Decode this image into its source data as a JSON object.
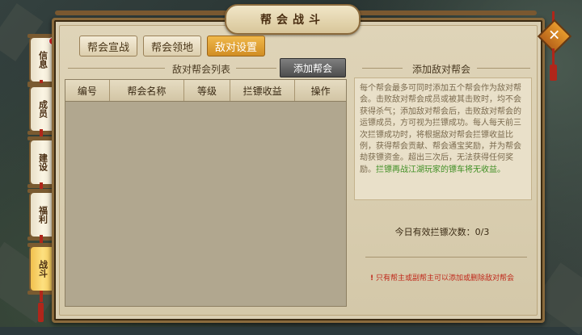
{
  "window": {
    "title": "帮会战斗"
  },
  "tabs": [
    {
      "label": "帮会宣战",
      "active": false
    },
    {
      "label": "帮会领地",
      "active": false
    },
    {
      "label": "敌对设置",
      "active": true
    }
  ],
  "left_section": {
    "title": "敌对帮会列表",
    "add_button": "添加帮会",
    "columns": [
      "编号",
      "帮会名称",
      "等级",
      "拦镖收益",
      "操作"
    ],
    "rows": []
  },
  "right_section": {
    "title": "添加敌对帮会",
    "description": "每个帮会最多可同时添加五个帮会作为敌对帮会。击败敌对帮会成员或被其击败时，均不会获得杀气；添加敌对帮会后，击败敌对帮会的运镖成员，方可视为拦镖成功。每人每天前三次拦镖成功时，将根据敌对帮会拦镖收益比例，获得帮会贡献、帮会通宝奖励，并为帮会劫获镖资金。超出三次后，无法获得任何奖励。",
    "description_highlight": "拦镖再战江湖玩家的镖车将无收益。",
    "daily_count_label": "今日有效拦镖次数：",
    "daily_count_value": "0/3",
    "warning_icon": "exclamation-icon",
    "warning": "只有帮主或副帮主可以添加或删除敌对帮会"
  },
  "side_nav": [
    {
      "label": "信息",
      "active": false,
      "badge": true
    },
    {
      "label": "成员",
      "active": false,
      "badge": false
    },
    {
      "label": "建设",
      "active": false,
      "badge": false
    },
    {
      "label": "福利",
      "active": false,
      "badge": false
    },
    {
      "label": "战斗",
      "active": true,
      "badge": false
    }
  ],
  "close_button": {
    "label": "✕",
    "icon": "close-icon"
  },
  "colors": {
    "tab_active": "#d18e24",
    "highlight_text": "#3f8f24",
    "warning_text": "#c0281a",
    "panel_bg": "#d9ceb2"
  }
}
